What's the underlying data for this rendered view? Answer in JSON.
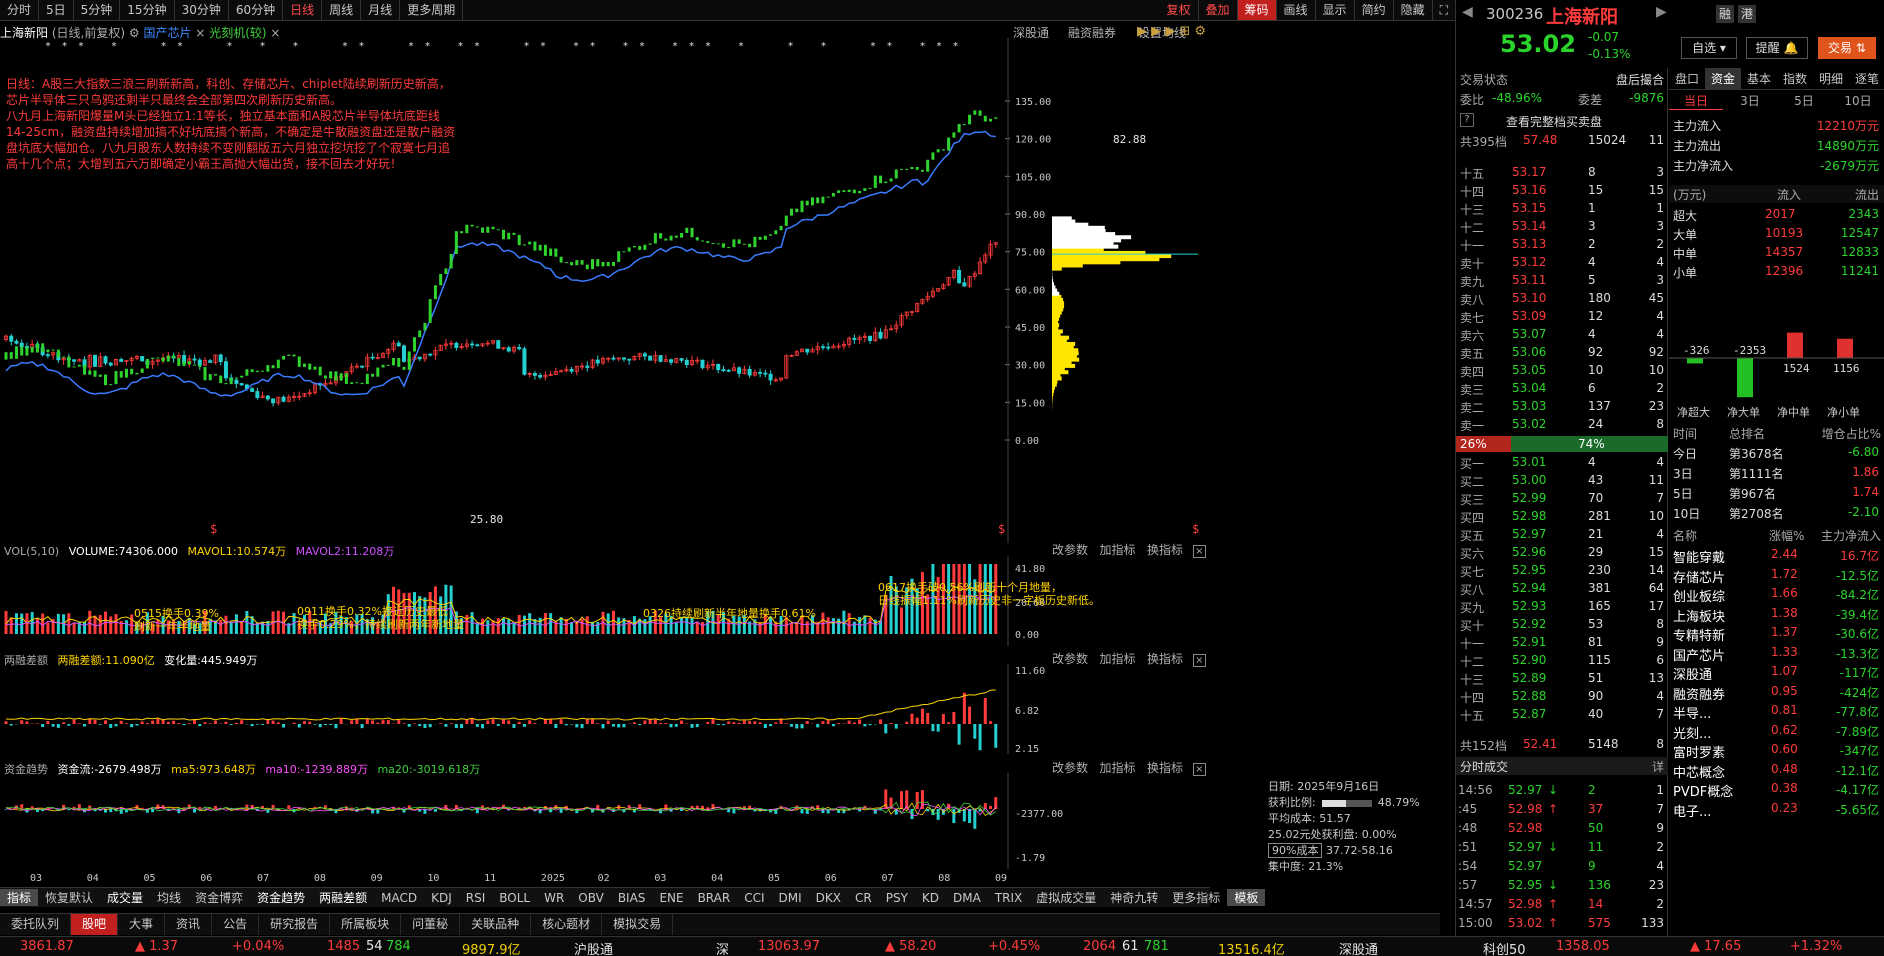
{
  "periods": [
    "分时",
    "5日",
    "5分钟",
    "15分钟",
    "30分钟",
    "60分钟",
    "日线",
    "周线",
    "月线",
    "更多周期"
  ],
  "toolbar": [
    "复权",
    "叠加",
    "筹码",
    "画线",
    "显示",
    "简约",
    "隐藏"
  ],
  "title": {
    "stock": "上海新阳",
    "mode": "(日线,前复权)",
    "block": "国产芯片",
    "overlay": "光刻机(较)"
  },
  "title_right": [
    "深股通",
    "融资融券",
    "设置均线"
  ],
  "annotation": "日线：A股三大指数三浪三刷新新高，科创、存储芯片、chiplet陆续刷新历史新高，芯片半导体三只乌鸦还剩半只最终会全部第四次刷新历史新高。\n八九月上海新阳爆量M头已经独立1:1等长，独立基本面和A股芯片半导体坑底距线14-25cm，融资盘持续增加搞不好坑底搞个新高，不确定是牛散融资盘还是散户融资盘坑底大幅加仓。八九月股东人数持续不变刚翻版五六月独立挖坑挖了个寂寞七月追高十几个点；大增到五六万即确定小霸王高抛大幅出货，接不回去才好玩！",
  "price_axis": [
    "135.00",
    "120.00",
    "105.00",
    "90.00",
    "75.00",
    "60.00",
    "45.00",
    "30.00",
    "15.00",
    "0.00"
  ],
  "chart_labels": {
    "low": "25.80",
    "high_line": "82.88"
  },
  "vol": {
    "title": "VOL(5,10)",
    "volume": "VOLUME:74306.000",
    "mavol1": "MAVOL1:10.574万",
    "mavol2": "MAVOL2:11.208万",
    "axis": [
      "41.80",
      "20.60",
      "0.00"
    ],
    "notes": [
      "0515换手0.39%\n刷新一年半地量",
      "0911换手0.32%接近历史最低\n换手0.29%，持续刷新两年新地量",
      "0326持续刷新半年地量换手0.61%",
      "0617换手破0.56%刷新十个月地量，\n日线振幅1.11%刷新历史非一字板历史新低。"
    ]
  },
  "margin": {
    "title": "两融差额",
    "value": "两融差额:11.090亿",
    "change": "变化量:445.949万",
    "axis": [
      "11.60",
      "6.82",
      "2.15"
    ]
  },
  "fund": {
    "title": "资金趋势",
    "flow": "资金流:-2679.498万",
    "ma5": "ma5:973.648万",
    "ma10": "ma10:-1239.889万",
    "ma20": "ma20:-3019.618万",
    "axis": [
      "-2377.00",
      "-1.79"
    ]
  },
  "panel_links": [
    "改参数",
    "加指标",
    "换指标"
  ],
  "x_axis": [
    "03",
    "04",
    "05",
    "06",
    "07",
    "08",
    "09",
    "10",
    "11",
    "2025",
    "02",
    "03",
    "04",
    "05",
    "06",
    "07",
    "08",
    "09"
  ],
  "cost": {
    "date": "日期: 2025年9月16日",
    "profit_label": "获利比例:",
    "profit": "48.79%",
    "avg": "平均成本: 51.57",
    "pos": "25.02元处获利盘: 0.00%",
    "range_sel": "90%成本",
    "range": "37.72-58.16",
    "conc": "集中度: 21.3%"
  },
  "indicator_tabs": [
    "指标",
    "恢复默认",
    "成交量",
    "均线",
    "资金博弈",
    "资金趋势",
    "两融差额",
    "MACD",
    "KDJ",
    "RSI",
    "BOLL",
    "WR",
    "OBV",
    "BIAS",
    "ENE",
    "BRAR",
    "CCI",
    "DMI",
    "DKX",
    "CR",
    "PSY",
    "KD",
    "DMA",
    "TRIX",
    "虚拟成交量",
    "神奇九转",
    "更多指标",
    "模板"
  ],
  "bottom_tabs": [
    "委托队列",
    "股吧",
    "大事",
    "资讯",
    "公告",
    "研究报告",
    "所属板块",
    "问董秘",
    "关联品种",
    "核心题材",
    "模拟交易"
  ],
  "status": {
    "sh": "3861.87",
    "sh_chg": "▲ 1.37",
    "sh_pct": "+0.04%",
    "sh_n1": "1485",
    "sh_n2": "54",
    "sh_n3": "784",
    "sh_amt": "9897.9亿",
    "hgt": "沪股通",
    "sz_label": "深",
    "sz": "13063.97",
    "sz_chg": "▲ 58.20",
    "sz_pct": "+0.45%",
    "sz_n1": "2064",
    "sz_n2": "61",
    "sz_n3": "781",
    "sz_amt": "13516.4亿",
    "sgt": "深股通",
    "kc": "科创50",
    "kc_v": "1358.05",
    "kc_chg": "▲ 17.65",
    "kc_pct": "+1.32%"
  },
  "quote": {
    "code": "300236",
    "name": "上海新阳",
    "price": "53.02",
    "chg": "-0.07",
    "pct": "-0.13%",
    "b1": "融",
    "b2": "港",
    "self": "自选",
    "remind": "提醒",
    "trade": "交易"
  },
  "trade_state": {
    "label": "交易状态",
    "value": "盘后撮合",
    "wb_label": "委比",
    "wb": "-48.96%",
    "wc_label": "委差",
    "wc": "-9876",
    "book_btn": "查看完整档买卖盘",
    "total_sell": "共395档",
    "ts_price": "57.48",
    "ts_vol": "15024",
    "ts_n": "11",
    "total_buy": "共152档",
    "tb_price": "52.41",
    "tb_vol": "5148",
    "tb_n": "8",
    "bar_l": "26%",
    "bar_r": "74%"
  },
  "asks": [
    [
      "十五",
      "53.17",
      "8",
      "3"
    ],
    [
      "十四",
      "53.16",
      "15",
      "15"
    ],
    [
      "十三",
      "53.15",
      "1",
      "1"
    ],
    [
      "十二",
      "53.14",
      "3",
      "3"
    ],
    [
      "十一",
      "53.13",
      "2",
      "2"
    ],
    [
      "卖十",
      "53.12",
      "4",
      "4"
    ],
    [
      "卖九",
      "53.11",
      "5",
      "3"
    ],
    [
      "卖八",
      "53.10",
      "180",
      "45"
    ],
    [
      "卖七",
      "53.09",
      "12",
      "4"
    ],
    [
      "卖六",
      "53.07",
      "4",
      "4"
    ],
    [
      "卖五",
      "53.06",
      "92",
      "92"
    ],
    [
      "卖四",
      "53.05",
      "10",
      "10"
    ],
    [
      "卖三",
      "53.04",
      "6",
      "2"
    ],
    [
      "卖二",
      "53.03",
      "137",
      "23"
    ],
    [
      "卖一",
      "53.02",
      "24",
      "8"
    ]
  ],
  "bids": [
    [
      "买一",
      "53.01",
      "4",
      "4"
    ],
    [
      "买二",
      "53.00",
      "43",
      "11"
    ],
    [
      "买三",
      "52.99",
      "70",
      "7"
    ],
    [
      "买四",
      "52.98",
      "281",
      "10"
    ],
    [
      "买五",
      "52.97",
      "21",
      "4"
    ],
    [
      "买六",
      "52.96",
      "29",
      "15"
    ],
    [
      "买七",
      "52.95",
      "230",
      "14"
    ],
    [
      "买八",
      "52.94",
      "381",
      "64"
    ],
    [
      "买九",
      "52.93",
      "165",
      "17"
    ],
    [
      "买十",
      "52.92",
      "53",
      "8"
    ],
    [
      "十一",
      "52.91",
      "81",
      "9"
    ],
    [
      "十二",
      "52.90",
      "115",
      "6"
    ],
    [
      "十三",
      "52.89",
      "51",
      "13"
    ],
    [
      "十四",
      "52.88",
      "90",
      "4"
    ],
    [
      "十五",
      "52.87",
      "40",
      "7"
    ]
  ],
  "ticks_header": {
    "label": "分时成交",
    "btn": "详"
  },
  "ticks": [
    [
      "14:56",
      "52.97",
      "↓",
      "2",
      "1"
    ],
    [
      ":45",
      "52.98",
      "↑",
      "37",
      "7"
    ],
    [
      ":48",
      "52.98",
      "",
      "50",
      "9"
    ],
    [
      ":51",
      "52.97",
      "↓",
      "11",
      "2"
    ],
    [
      ":54",
      "52.97",
      "",
      "9",
      "4"
    ],
    [
      ":57",
      "52.95",
      "↓",
      "136",
      "23"
    ],
    [
      "14:57",
      "52.98",
      "↑",
      "14",
      "2"
    ],
    [
      "15:00",
      "53.02",
      "↑",
      "575",
      "133"
    ]
  ],
  "flow_tabs": [
    "盘口",
    "资金",
    "基本",
    "指数",
    "明细",
    "逐笔"
  ],
  "flow_periods": [
    "当日",
    "3日",
    "5日",
    "10日"
  ],
  "main_flow": [
    [
      "主力流入",
      "12210万元"
    ],
    [
      "主力流出",
      "14890万元"
    ],
    [
      "主力净流入",
      "-2679万元"
    ]
  ],
  "flow_table_head": [
    "(万元)",
    "流入",
    "流出"
  ],
  "flow_table": [
    [
      "超大",
      "2017",
      "2343"
    ],
    [
      "大单",
      "10193",
      "12547"
    ],
    [
      "中单",
      "14357",
      "12833"
    ],
    [
      "小单",
      "12396",
      "11241"
    ]
  ],
  "net_bars": {
    "values": [
      -326,
      -2353,
      1524,
      1156
    ],
    "labels": [
      "-326",
      "-2353",
      "1524",
      "1156"
    ],
    "cats": [
      "净超大",
      "净大单",
      "净中单",
      "净小单"
    ]
  },
  "rank_head": [
    "时间",
    "总排名",
    "增仓占比%"
  ],
  "ranks": [
    [
      "今日",
      "第3678名",
      "-6.80"
    ],
    [
      "3日",
      "第1111名",
      "1.86"
    ],
    [
      "5日",
      "第967名",
      "1.74"
    ],
    [
      "10日",
      "第2708名",
      "-2.10"
    ]
  ],
  "sector_head": [
    "名称",
    "涨幅%",
    "主力净流入"
  ],
  "sectors": [
    [
      "智能穿戴",
      "2.44",
      "16.7亿"
    ],
    [
      "存储芯片",
      "1.72",
      "-12.5亿"
    ],
    [
      "创业板综",
      "1.66",
      "-84.2亿"
    ],
    [
      "上海板块",
      "1.38",
      "-39.4亿"
    ],
    [
      "专精特新",
      "1.37",
      "-30.6亿"
    ],
    [
      "国产芯片",
      "1.33",
      "-13.3亿"
    ],
    [
      "深股通",
      "1.07",
      "-117亿"
    ],
    [
      "融资融券",
      "0.95",
      "-424亿"
    ],
    [
      "半导...",
      "0.81",
      "-77.8亿"
    ],
    [
      "光刻...",
      "0.62",
      "-7.89亿"
    ],
    [
      "富时罗素",
      "0.60",
      "-347亿"
    ],
    [
      "中芯概念",
      "0.48",
      "-12.1亿"
    ],
    [
      "PVDF概念",
      "0.38",
      "-4.17亿"
    ],
    [
      "电子...",
      "0.23",
      "-5.65亿"
    ]
  ]
}
